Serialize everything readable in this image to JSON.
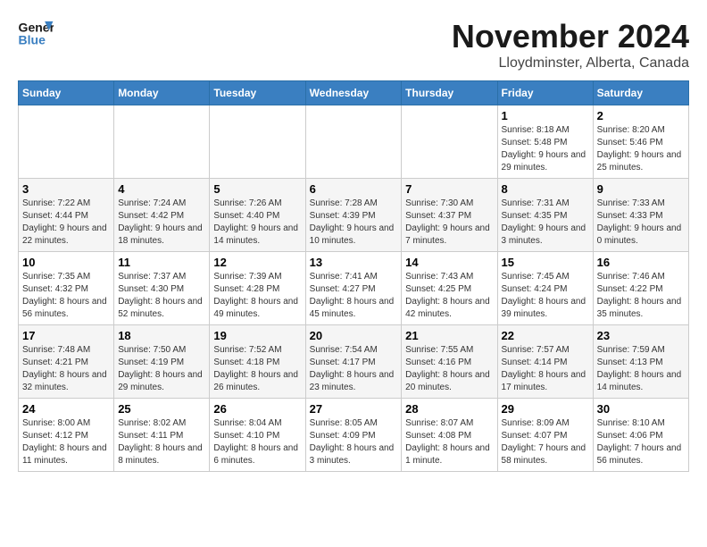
{
  "logo": {
    "line1": "General",
    "line2": "Blue"
  },
  "title": "November 2024",
  "location": "Lloydminster, Alberta, Canada",
  "weekdays": [
    "Sunday",
    "Monday",
    "Tuesday",
    "Wednesday",
    "Thursday",
    "Friday",
    "Saturday"
  ],
  "weeks": [
    [
      {
        "day": "",
        "info": ""
      },
      {
        "day": "",
        "info": ""
      },
      {
        "day": "",
        "info": ""
      },
      {
        "day": "",
        "info": ""
      },
      {
        "day": "",
        "info": ""
      },
      {
        "day": "1",
        "info": "Sunrise: 8:18 AM\nSunset: 5:48 PM\nDaylight: 9 hours and 29 minutes."
      },
      {
        "day": "2",
        "info": "Sunrise: 8:20 AM\nSunset: 5:46 PM\nDaylight: 9 hours and 25 minutes."
      }
    ],
    [
      {
        "day": "3",
        "info": "Sunrise: 7:22 AM\nSunset: 4:44 PM\nDaylight: 9 hours and 22 minutes."
      },
      {
        "day": "4",
        "info": "Sunrise: 7:24 AM\nSunset: 4:42 PM\nDaylight: 9 hours and 18 minutes."
      },
      {
        "day": "5",
        "info": "Sunrise: 7:26 AM\nSunset: 4:40 PM\nDaylight: 9 hours and 14 minutes."
      },
      {
        "day": "6",
        "info": "Sunrise: 7:28 AM\nSunset: 4:39 PM\nDaylight: 9 hours and 10 minutes."
      },
      {
        "day": "7",
        "info": "Sunrise: 7:30 AM\nSunset: 4:37 PM\nDaylight: 9 hours and 7 minutes."
      },
      {
        "day": "8",
        "info": "Sunrise: 7:31 AM\nSunset: 4:35 PM\nDaylight: 9 hours and 3 minutes."
      },
      {
        "day": "9",
        "info": "Sunrise: 7:33 AM\nSunset: 4:33 PM\nDaylight: 9 hours and 0 minutes."
      }
    ],
    [
      {
        "day": "10",
        "info": "Sunrise: 7:35 AM\nSunset: 4:32 PM\nDaylight: 8 hours and 56 minutes."
      },
      {
        "day": "11",
        "info": "Sunrise: 7:37 AM\nSunset: 4:30 PM\nDaylight: 8 hours and 52 minutes."
      },
      {
        "day": "12",
        "info": "Sunrise: 7:39 AM\nSunset: 4:28 PM\nDaylight: 8 hours and 49 minutes."
      },
      {
        "day": "13",
        "info": "Sunrise: 7:41 AM\nSunset: 4:27 PM\nDaylight: 8 hours and 45 minutes."
      },
      {
        "day": "14",
        "info": "Sunrise: 7:43 AM\nSunset: 4:25 PM\nDaylight: 8 hours and 42 minutes."
      },
      {
        "day": "15",
        "info": "Sunrise: 7:45 AM\nSunset: 4:24 PM\nDaylight: 8 hours and 39 minutes."
      },
      {
        "day": "16",
        "info": "Sunrise: 7:46 AM\nSunset: 4:22 PM\nDaylight: 8 hours and 35 minutes."
      }
    ],
    [
      {
        "day": "17",
        "info": "Sunrise: 7:48 AM\nSunset: 4:21 PM\nDaylight: 8 hours and 32 minutes."
      },
      {
        "day": "18",
        "info": "Sunrise: 7:50 AM\nSunset: 4:19 PM\nDaylight: 8 hours and 29 minutes."
      },
      {
        "day": "19",
        "info": "Sunrise: 7:52 AM\nSunset: 4:18 PM\nDaylight: 8 hours and 26 minutes."
      },
      {
        "day": "20",
        "info": "Sunrise: 7:54 AM\nSunset: 4:17 PM\nDaylight: 8 hours and 23 minutes."
      },
      {
        "day": "21",
        "info": "Sunrise: 7:55 AM\nSunset: 4:16 PM\nDaylight: 8 hours and 20 minutes."
      },
      {
        "day": "22",
        "info": "Sunrise: 7:57 AM\nSunset: 4:14 PM\nDaylight: 8 hours and 17 minutes."
      },
      {
        "day": "23",
        "info": "Sunrise: 7:59 AM\nSunset: 4:13 PM\nDaylight: 8 hours and 14 minutes."
      }
    ],
    [
      {
        "day": "24",
        "info": "Sunrise: 8:00 AM\nSunset: 4:12 PM\nDaylight: 8 hours and 11 minutes."
      },
      {
        "day": "25",
        "info": "Sunrise: 8:02 AM\nSunset: 4:11 PM\nDaylight: 8 hours and 8 minutes."
      },
      {
        "day": "26",
        "info": "Sunrise: 8:04 AM\nSunset: 4:10 PM\nDaylight: 8 hours and 6 minutes."
      },
      {
        "day": "27",
        "info": "Sunrise: 8:05 AM\nSunset: 4:09 PM\nDaylight: 8 hours and 3 minutes."
      },
      {
        "day": "28",
        "info": "Sunrise: 8:07 AM\nSunset: 4:08 PM\nDaylight: 8 hours and 1 minute."
      },
      {
        "day": "29",
        "info": "Sunrise: 8:09 AM\nSunset: 4:07 PM\nDaylight: 7 hours and 58 minutes."
      },
      {
        "day": "30",
        "info": "Sunrise: 8:10 AM\nSunset: 4:06 PM\nDaylight: 7 hours and 56 minutes."
      }
    ]
  ]
}
